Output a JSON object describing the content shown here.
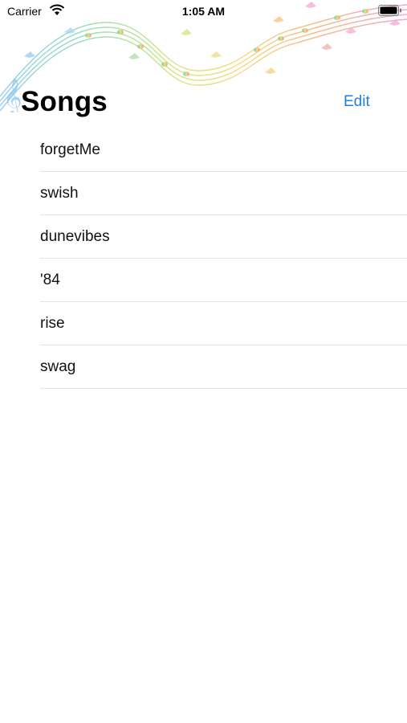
{
  "status_bar": {
    "carrier": "Carrier",
    "time": "1:05 AM",
    "wifi_icon": "wifi-icon",
    "battery_icon": "battery-icon"
  },
  "banner": {
    "image": "music-staff-butterflies-banner"
  },
  "nav": {
    "title": "Songs",
    "edit_label": "Edit"
  },
  "songs": [
    {
      "title": "forgetMe"
    },
    {
      "title": "swish"
    },
    {
      "title": "dunevibes"
    },
    {
      "title": "'84"
    },
    {
      "title": "rise"
    },
    {
      "title": "swag"
    }
  ],
  "colors": {
    "accent": "#1e82dc",
    "separator": "#e2e2e4",
    "background": "#ffffff"
  }
}
